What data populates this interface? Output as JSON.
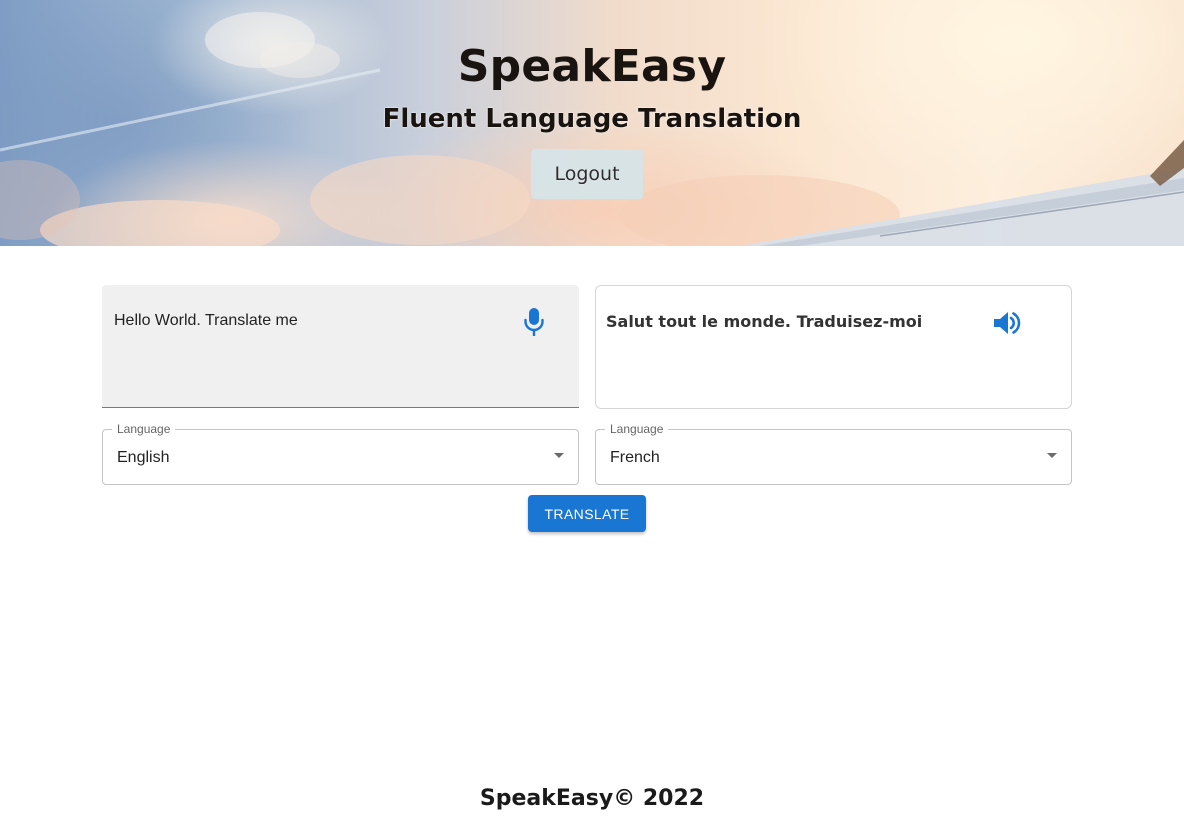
{
  "header": {
    "title": "SpeakEasy",
    "subtitle": "Fluent Language Translation",
    "logout_label": "Logout"
  },
  "source": {
    "text": "Hello World. Translate me",
    "icon": "microphone-icon",
    "language_label": "Language",
    "language_value": "English"
  },
  "target": {
    "text": "Salut tout le monde. Traduisez-moi",
    "icon": "speaker-icon",
    "language_label": "Language",
    "language_value": "French"
  },
  "actions": {
    "translate_label": "TRANSLATE"
  },
  "footer": {
    "text": "SpeakEasy© 2022"
  },
  "colors": {
    "accent": "#1976d2",
    "icon_blue": "#1976d2"
  }
}
